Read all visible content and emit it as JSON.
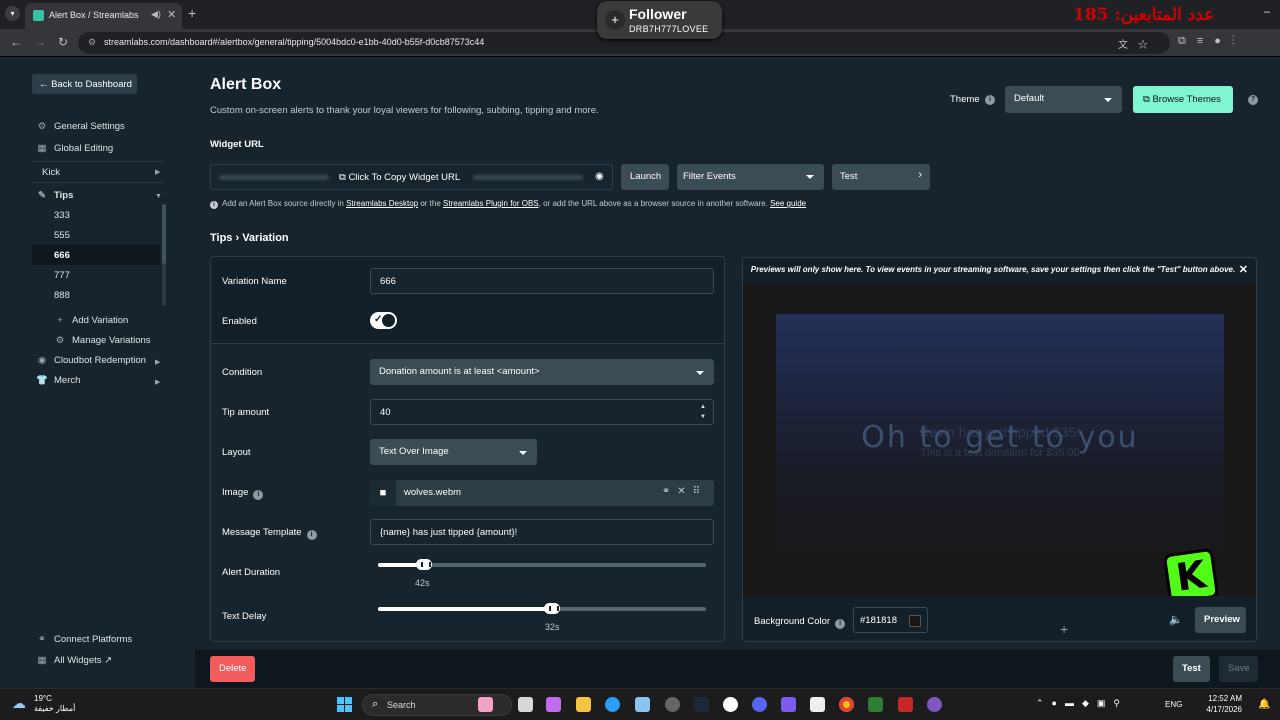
{
  "browser": {
    "tab_title": "Alert Box / Streamlabs",
    "url": "streamlabs.com/dashboard#/alertbox/general/tipping/5004bdc0-e1bb-40d0-b55f-d0cb87573c44",
    "new_tab_symbol": "+",
    "close_symbol": "✕",
    "minimize_symbol": "–"
  },
  "overlay": {
    "follower_title": "Follower",
    "follower_name": "DRB7H777LOVEE",
    "arabic_counter": "عدد المتابعين: 185"
  },
  "sidebar": {
    "back_label": "Back to Dashboard",
    "items": [
      {
        "label": "General Settings",
        "icon": "gear-icon"
      },
      {
        "label": "Global Editing",
        "icon": "grid-icon"
      },
      {
        "label": "Kick",
        "icon": ""
      },
      {
        "label": "Tips",
        "icon": "tip-icon"
      }
    ],
    "variations": [
      "333",
      "555",
      "666",
      "777",
      "888"
    ],
    "selected_variation": "666",
    "add_variation": "Add Variation",
    "manage_variations": "Manage Variations",
    "cloudbot": "Cloudbot Redemption",
    "merch": "Merch",
    "connect_platforms": "Connect Platforms",
    "all_widgets": "All Widgets"
  },
  "header": {
    "title": "Alert Box",
    "description": "Custom on-screen alerts to thank your loyal viewers for following, subbing, tipping and more.",
    "theme_label": "Theme",
    "theme_value": "Default",
    "browse_themes": "Browse Themes"
  },
  "widget": {
    "label": "Widget URL",
    "copy_label": "Click To Copy Widget URL",
    "launch": "Launch",
    "filter_events": "Filter Events",
    "test": "Test",
    "hint_pre": "Add an Alert Box source directly in",
    "hint_link1": "Streamlabs Desktop",
    "hint_mid1": "or the",
    "hint_link2": "Streamlabs Plugin for OBS",
    "hint_mid2": ", or add the URL above as a browser source in another software.",
    "hint_link3": "See guide"
  },
  "breadcrumb": "Tips › Variation",
  "form": {
    "variation_name_label": "Variation Name",
    "variation_name_value": "666",
    "enabled_label": "Enabled",
    "enabled": true,
    "condition_label": "Condition",
    "condition_value": "Donation amount is at least <amount>",
    "tip_amount_label": "Tip amount",
    "tip_amount_value": "40",
    "layout_label": "Layout",
    "layout_value": "Text Over Image",
    "image_label": "Image",
    "image_value": "wolves.webm",
    "message_template_label": "Message Template",
    "message_template_value": "{name} has just tipped {amount}!",
    "alert_duration_label": "Alert Duration",
    "alert_duration_value": "42s",
    "alert_duration_fraction": 0.14,
    "text_delay_label": "Text Delay",
    "text_delay_value": "32s",
    "text_delay_fraction": 0.53
  },
  "preview": {
    "note": "Previews will only show here. To view events in your streaming software, save your settings then click the \"Test\" button above.",
    "video_text": "Oh to get to you",
    "msg_line1": "Kevin has just tipped $35!",
    "msg_line2": "This is a test donation for $35.00",
    "kick_letter": "K",
    "bg_color_label": "Background Color",
    "bg_color_value": "#181818",
    "preview_button": "Preview"
  },
  "footer": {
    "delete": "Delete",
    "test": "Test",
    "save": "Save"
  },
  "taskbar": {
    "temperature": "19°C",
    "weather_text": "أمطار خفيفة",
    "search": "Search",
    "lang": "ENG",
    "time": "12:52 AM",
    "date": "4/17/2026"
  },
  "colors": {
    "accent": "#80f5d2",
    "danger": "#f25c5c",
    "background": "#17242d",
    "kick_green": "#53fc18"
  }
}
